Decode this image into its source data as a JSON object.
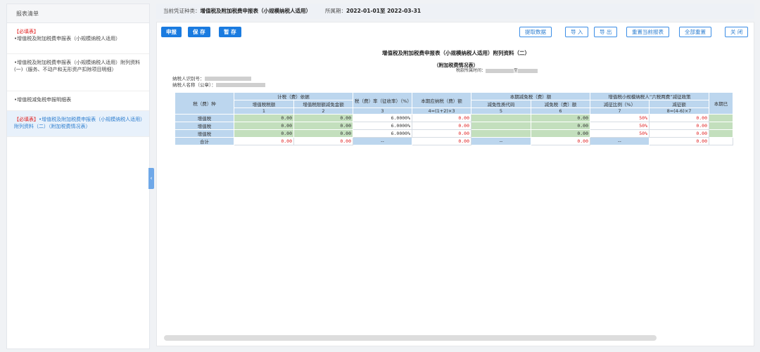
{
  "sidebar": {
    "title": "报表清单",
    "collapse": "‹",
    "items": [
      {
        "req": "【必填表】",
        "label": "•增值税及附加税费申报表（小规模纳税人适用）",
        "active": false
      },
      {
        "req": "",
        "label": "•增值税及附加税费申报表（小规模纳税人适用）附列资料(一)（服务、不动产和无形资产扣除项目明细）",
        "active": false
      },
      {
        "req": "",
        "label": "•增值税减免税申报明细表",
        "active": false
      },
      {
        "req": "【必填表】",
        "label": "•增值税及附加税费申报表（小规模纳税人适用）附列资料（二）（附加税费情况表）",
        "active": true
      }
    ]
  },
  "topbar": {
    "voucher_label": "当前凭证种类：",
    "voucher_value": "增值税及附加税费申报表（小规模纳税人适用）",
    "period_label": "所属期：",
    "period_value": "2022-01-01至 2022-03-31"
  },
  "toolbar": {
    "declare": "申报",
    "save": "保 存",
    "temp_save": "暂 存",
    "fetch": "提取数据",
    "import": "导 入",
    "export": "导 出",
    "reset_current": "重置当前报表",
    "reset_all": "全部重置",
    "close": "关 闭"
  },
  "report": {
    "title": "增值税及附加税费申报表（小规模纳税人适用）附列资料（二）",
    "subtitle": "（附加税费情况表）",
    "period_label": "税款所属时间：",
    "period_mid": "至",
    "taxpayer_id_label": "纳税人识别号：",
    "taxpayer_name_label": "纳税人名称（公章）："
  },
  "table": {
    "col_tax": "税（费）种",
    "grp_basis": "计税（费）依据",
    "grp_reduce": "本期减免税（费）额",
    "grp_six": "增值税小规模纳税人“六税两费”减征政策",
    "col_vat": "增值税税额",
    "col_vat_credit": "增值税限额减免金额",
    "col_rate": "税（费）率（征收率）（%）",
    "col_payable": "本期应纳税（费）额",
    "col_code": "减免性质代码",
    "col_reduce_amt": "减免税（费）额",
    "col_ratio": "减征比例（%）",
    "col_reduce2": "减征额",
    "col_paid": "本期已",
    "idx": [
      "1",
      "2",
      "3",
      "4=(1+2)×3",
      "5",
      "6",
      "7",
      "8=(4-6)×7"
    ],
    "rows": [
      {
        "name": "增值税",
        "c1": "0.00",
        "c2": "0.00",
        "c3": "6.0000%",
        "c4": "0.00",
        "c6": "0.00",
        "c7": "50%",
        "c8": "0.00"
      },
      {
        "name": "增值税",
        "c1": "0.00",
        "c2": "0.00",
        "c3": "6.0000%",
        "c4": "0.00",
        "c6": "0.00",
        "c7": "50%",
        "c8": "0.00"
      },
      {
        "name": "增值税",
        "c1": "0.00",
        "c2": "0.00",
        "c3": "6.0000%",
        "c4": "0.00",
        "c6": "0.00",
        "c7": "50%",
        "c8": "0.00"
      }
    ],
    "total": {
      "name": "合计",
      "c1": "0.00",
      "c2": "0.00",
      "c3": "--",
      "c4": "0.00",
      "c5": "--",
      "c6": "0.00",
      "c7": "--",
      "c8": "0.00"
    }
  }
}
